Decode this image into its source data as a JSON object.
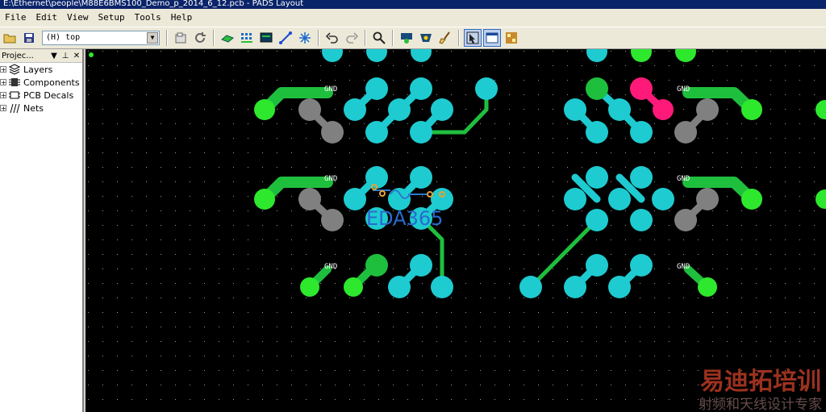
{
  "window": {
    "title": "E:\\Ethernet\\people\\M88E6BMS100_Demo_p_2014_6_12.pcb - PADS Layout"
  },
  "menu": [
    {
      "label": "File",
      "key": "F"
    },
    {
      "label": "Edit",
      "key": "E"
    },
    {
      "label": "View",
      "key": "V"
    },
    {
      "label": "Setup",
      "key": "S"
    },
    {
      "label": "Tools",
      "key": "T"
    },
    {
      "label": "Help",
      "key": "H"
    }
  ],
  "toolbar": {
    "layer_value": "(H) top"
  },
  "panel": {
    "title": "Projec...",
    "pin_glyph": "▼",
    "dock_glyph": "⊥",
    "close_glyph": "✕",
    "items": [
      "Layers",
      "Components",
      "PCB Decals",
      "Nets"
    ]
  },
  "board": {
    "net_label": "GND",
    "colors": {
      "background": "#000000",
      "grid": "#9a9a9a",
      "trace": "#1fbf3e",
      "pad_cyan": "#1ecbd0",
      "pad_green": "#2ee82e",
      "pad_gray": "#808080",
      "pad_magenta": "#ff1a7a"
    }
  },
  "watermark": {
    "logo_text": "EDA365",
    "brand_cn": "易迪拓培训",
    "slogan_cn": "射频和天线设计专家"
  }
}
